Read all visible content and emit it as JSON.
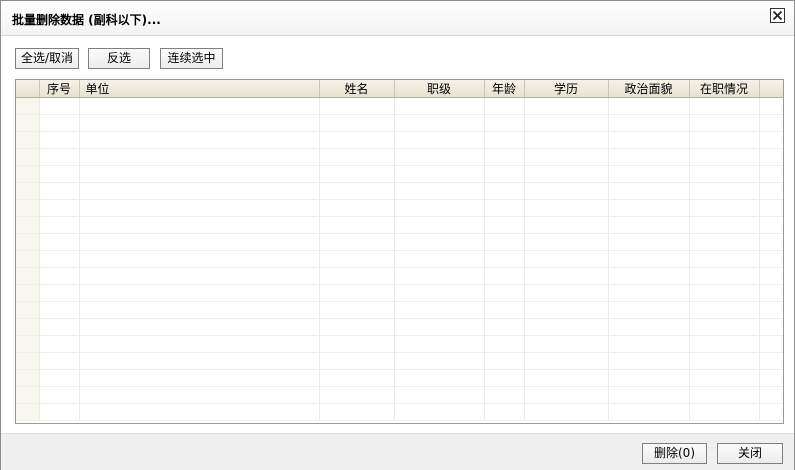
{
  "dialog": {
    "title": "批量删除数据 (副科以下)...",
    "close_icon": "close-icon"
  },
  "toolbar": {
    "select_all_label": "全选/取消",
    "invert_label": "反选",
    "continuous_select_label": "连续选中"
  },
  "grid": {
    "columns": [
      "",
      "序号",
      "单位",
      "姓名",
      "职级",
      "年龄",
      "学历",
      "政治面貌",
      "在职情况",
      ""
    ],
    "rows": []
  },
  "footer": {
    "delete_label": "删除(0)",
    "close_label": "关闭"
  }
}
